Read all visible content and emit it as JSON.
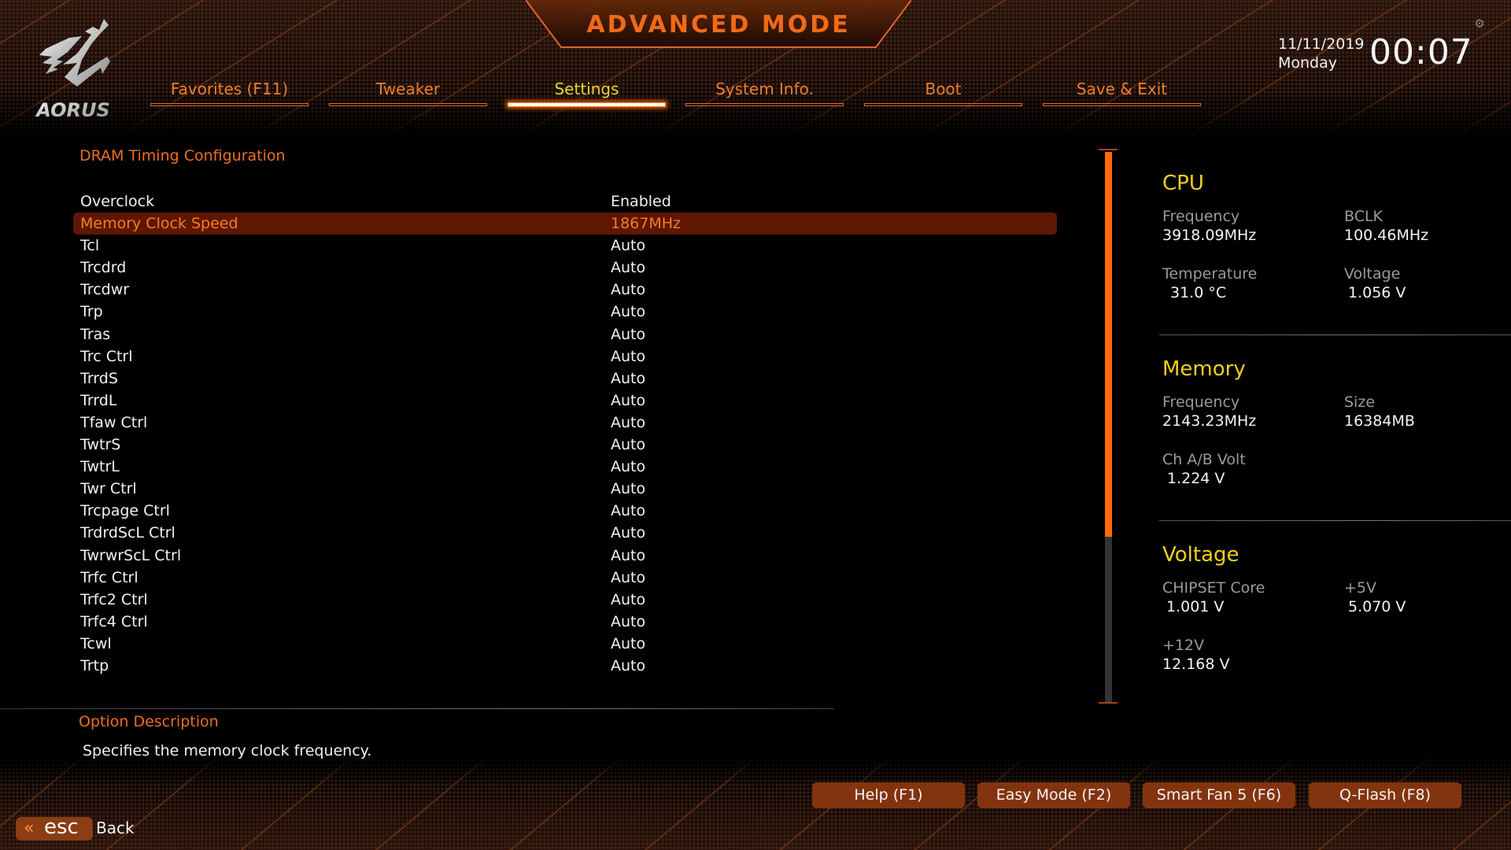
{
  "header": {
    "title": "ADVANCED MODE",
    "brand": "AORUS",
    "date": "11/11/2019",
    "day": "Monday",
    "time": "00:07"
  },
  "tabs": [
    {
      "label": "Favorites (F11)",
      "active": false
    },
    {
      "label": "Tweaker",
      "active": false
    },
    {
      "label": "Settings",
      "active": true
    },
    {
      "label": "System Info.",
      "active": false
    },
    {
      "label": "Boot",
      "active": false
    },
    {
      "label": "Save & Exit",
      "active": false
    }
  ],
  "main": {
    "section_title": "DRAM Timing Configuration",
    "selected_index": 1,
    "rows": [
      {
        "name": "Overclock",
        "value": "Enabled"
      },
      {
        "name": "Memory Clock Speed",
        "value": "1867MHz"
      },
      {
        "name": "Tcl",
        "value": "Auto"
      },
      {
        "name": "Trcdrd",
        "value": "Auto"
      },
      {
        "name": "Trcdwr",
        "value": "Auto"
      },
      {
        "name": "Trp",
        "value": "Auto"
      },
      {
        "name": "Tras",
        "value": "Auto"
      },
      {
        "name": "Trc Ctrl",
        "value": "Auto"
      },
      {
        "name": "TrrdS",
        "value": "Auto"
      },
      {
        "name": "TrrdL",
        "value": "Auto"
      },
      {
        "name": "Tfaw Ctrl",
        "value": "Auto"
      },
      {
        "name": "TwtrS",
        "value": "Auto"
      },
      {
        "name": "TwtrL",
        "value": "Auto"
      },
      {
        "name": "Twr Ctrl",
        "value": "Auto"
      },
      {
        "name": "Trcpage Ctrl",
        "value": "Auto"
      },
      {
        "name": "TrdrdScL Ctrl",
        "value": "Auto"
      },
      {
        "name": "TwrwrScL Ctrl",
        "value": "Auto"
      },
      {
        "name": "Trfc Ctrl",
        "value": "Auto"
      },
      {
        "name": "Trfc2 Ctrl",
        "value": "Auto"
      },
      {
        "name": "Trfc4 Ctrl",
        "value": "Auto"
      },
      {
        "name": "Tcwl",
        "value": "Auto"
      },
      {
        "name": "Trtp",
        "value": "Auto"
      }
    ],
    "scroll": {
      "thumb_start_fraction": 0.0,
      "thumb_size_fraction": 0.7
    }
  },
  "info_panel": {
    "cpu": {
      "title": "CPU",
      "frequency_label": "Frequency",
      "frequency": "3918.09MHz",
      "bclk_label": "BCLK",
      "bclk": "100.46MHz",
      "temperature_label": "Temperature",
      "temperature": "31.0 °C",
      "voltage_label": "Voltage",
      "voltage": "1.056 V"
    },
    "memory": {
      "title": "Memory",
      "frequency_label": "Frequency",
      "frequency": "2143.23MHz",
      "size_label": "Size",
      "size": "16384MB",
      "volt_label": "Ch A/B Volt",
      "volt": "1.224 V"
    },
    "voltage": {
      "title": "Voltage",
      "chipset_label": "CHIPSET Core",
      "chipset": "1.001 V",
      "v5_label": "+5V",
      "v5": "5.070 V",
      "v12_label": "+12V",
      "v12": "12.168 V"
    }
  },
  "description": {
    "title": "Option Description",
    "text": "Specifies the memory clock frequency."
  },
  "footer": {
    "buttons": [
      "Help (F1)",
      "Easy Mode (F2)",
      "Smart Fan 5 (F6)",
      "Q-Flash (F8)"
    ],
    "esc_label": "esc",
    "back_label": "Back"
  },
  "colors": {
    "accent": "#f06a16",
    "active_tab": "#e8d534",
    "panel_title": "#f0d01a",
    "highlight_bg": "#5e1703",
    "scroll_thumb": "#ff6a0a"
  }
}
